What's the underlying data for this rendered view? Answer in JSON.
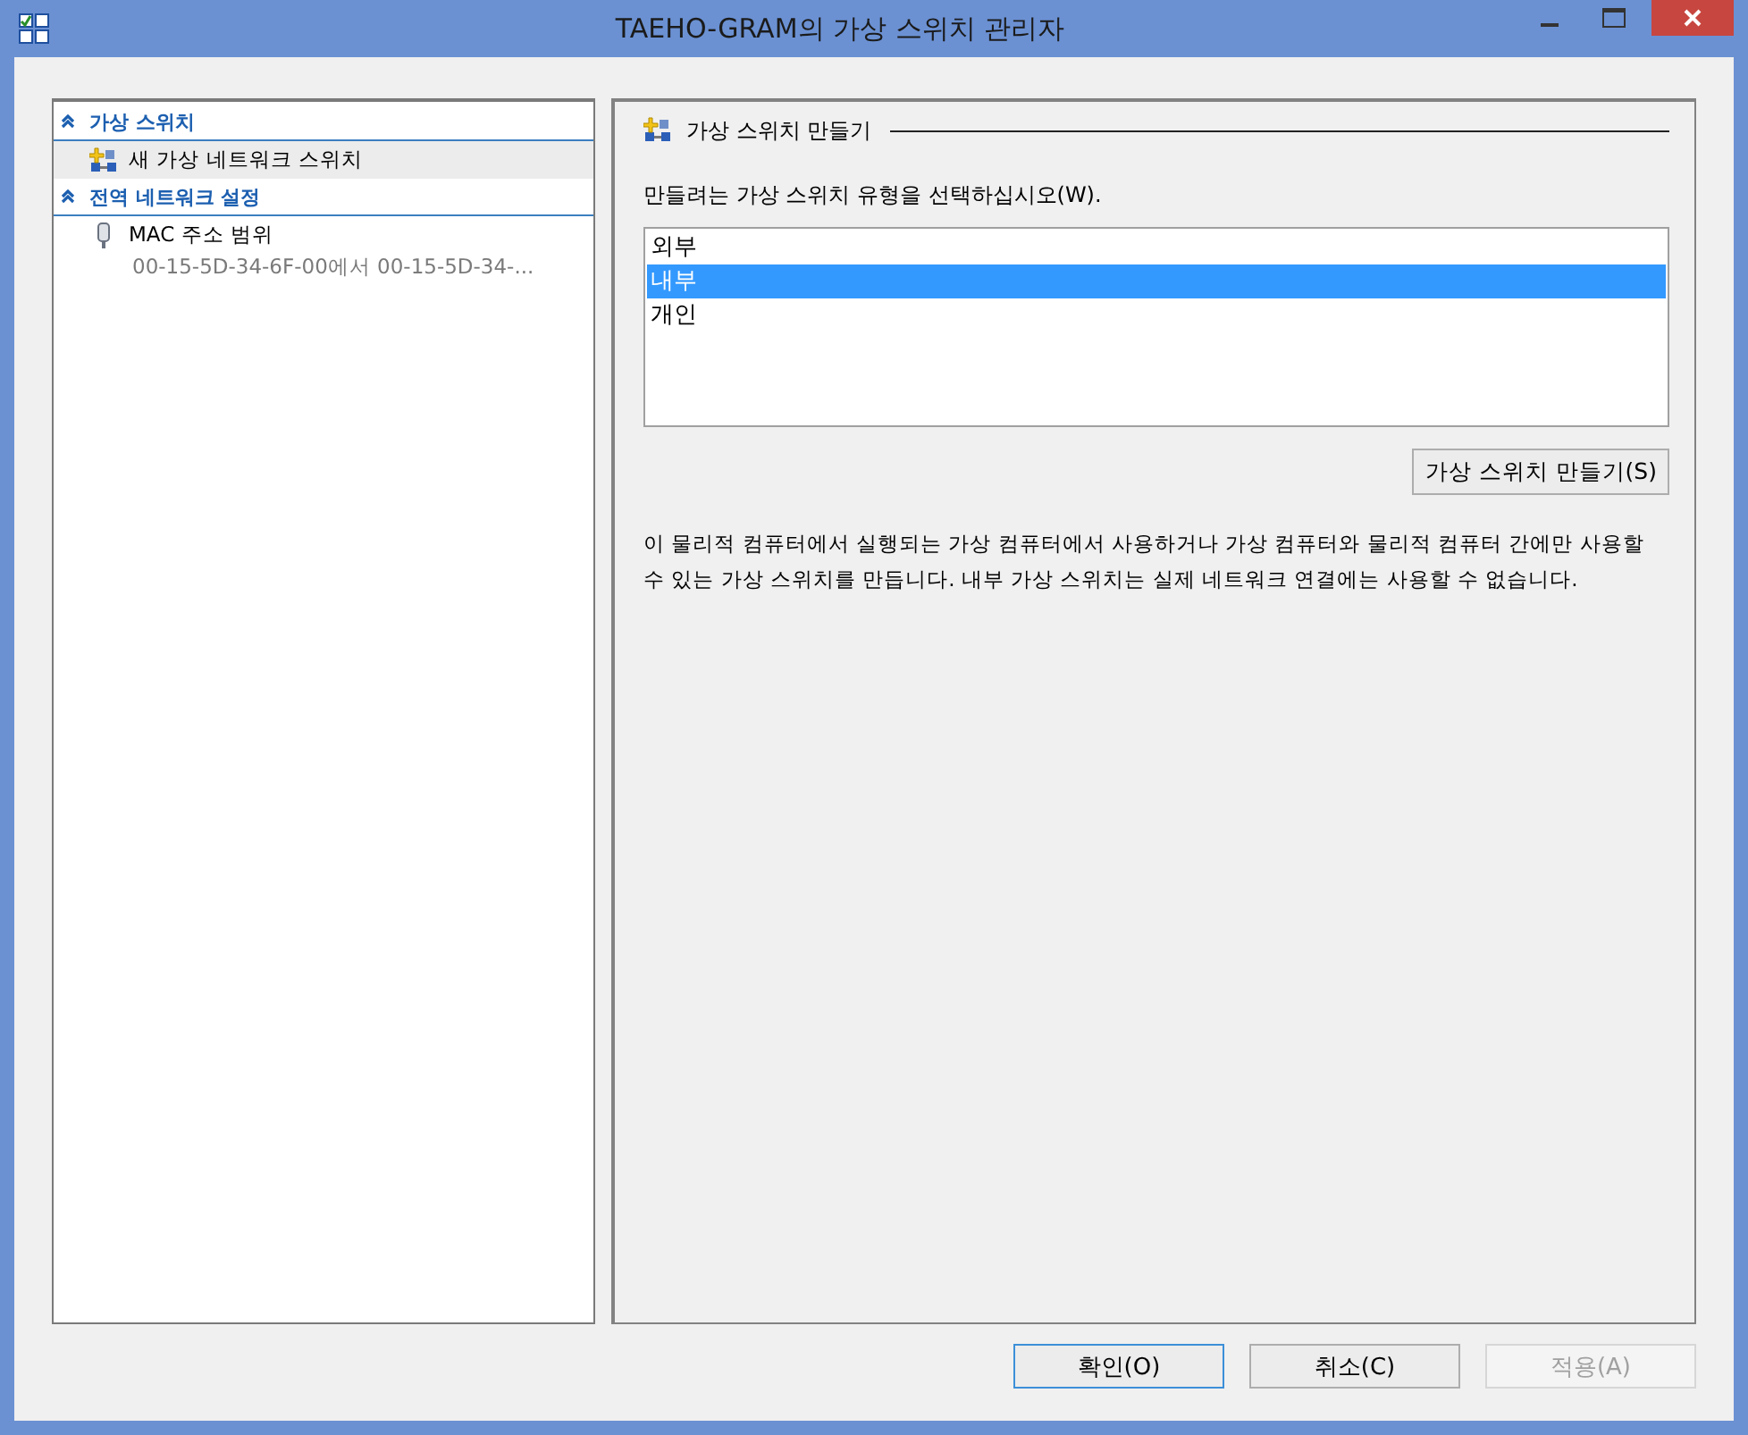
{
  "window": {
    "title": "TAEHO-GRAM의 가상 스위치 관리자"
  },
  "sidebar": {
    "sections": [
      {
        "title": "가상 스위치",
        "expanded": true,
        "items": [
          {
            "label": "새 가상 네트워크 스위치",
            "kind": "switch",
            "selected": true
          }
        ]
      },
      {
        "title": "전역 네트워크 설정",
        "expanded": true,
        "items": [
          {
            "label": "MAC 주소 범위",
            "detail": "00-15-5D-34-6F-00에서 00-15-5D-34-...",
            "kind": "plug",
            "selected": false
          }
        ]
      }
    ]
  },
  "panel": {
    "title": "가상 스위치 만들기",
    "prompt": "만들려는 가상 스위치 유형을 선택하십시오(W).",
    "types": [
      {
        "label": "외부",
        "selected": false
      },
      {
        "label": "내부",
        "selected": true
      },
      {
        "label": "개인",
        "selected": false
      }
    ],
    "create_button": "가상 스위치 만들기(S)",
    "description": "이 물리적 컴퓨터에서 실행되는 가상 컴퓨터에서 사용하거나 가상 컴퓨터와 물리적 컴퓨터 간에만 사용할 수 있는 가상 스위치를 만듭니다. 내부 가상 스위치는 실제 네트워크 연결에는 사용할 수 없습니다."
  },
  "buttons": [
    {
      "label": "확인(O)",
      "default": true,
      "disabled": false
    },
    {
      "label": "취소(C)",
      "default": false,
      "disabled": false
    },
    {
      "label": "적용(A)",
      "default": false,
      "disabled": true
    }
  ]
}
